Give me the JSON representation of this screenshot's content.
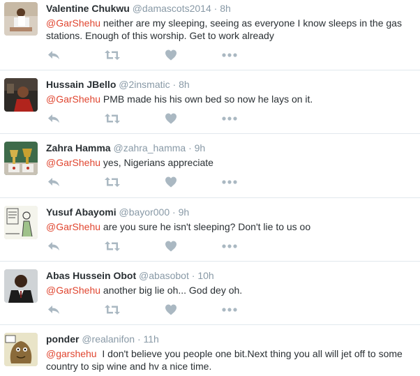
{
  "colors": {
    "mention": "#e0452f",
    "meta": "#8899a6",
    "icon": "#aab8c2",
    "text": "#292f33",
    "divider": "#e1e8ed"
  },
  "tweets": [
    {
      "name": "Valentine Chukwu",
      "handle": "@damascots2014",
      "time": "8h",
      "mention": "@GarShehu",
      "text": " neither are my sleeping, seeing as everyone I know sleeps in the gas stations. Enough of this worship. Get to work already",
      "avatar": "man-in-white-chair"
    },
    {
      "name": "Hussain JBello",
      "handle": "@2insmatic",
      "time": "8h",
      "mention": "@GarShehu",
      "text": " PMB made his his own bed so now he lays on it.",
      "avatar": "woman-in-red"
    },
    {
      "name": "Zahra Hamma",
      "handle": "@zahra_hamma",
      "time": "9h",
      "mention": "@GarShehu",
      "text": " yes, Nigerians appreciate",
      "avatar": "trophies"
    },
    {
      "name": "Yusuf Abayomi",
      "handle": "@bayor000",
      "time": "9h",
      "mention": "@GarShehu",
      "text": " are you sure he isn't sleeping? Don't lie to us oo",
      "avatar": "cartoon-sketch"
    },
    {
      "name": "Abas Hussein Obot",
      "handle": "@abasobot",
      "time": "10h",
      "mention": "@GarShehu",
      "text": " another big lie oh... God dey oh.",
      "avatar": "man-in-suit"
    },
    {
      "name": "ponder",
      "handle": "@realanifon",
      "time": "11h",
      "mention": "@garshehu",
      "text": "  I don't believe you people one bit.Next thing you all will jet off to some country to sip wine and hv a nice time.",
      "avatar": "cartoon-character"
    }
  ]
}
